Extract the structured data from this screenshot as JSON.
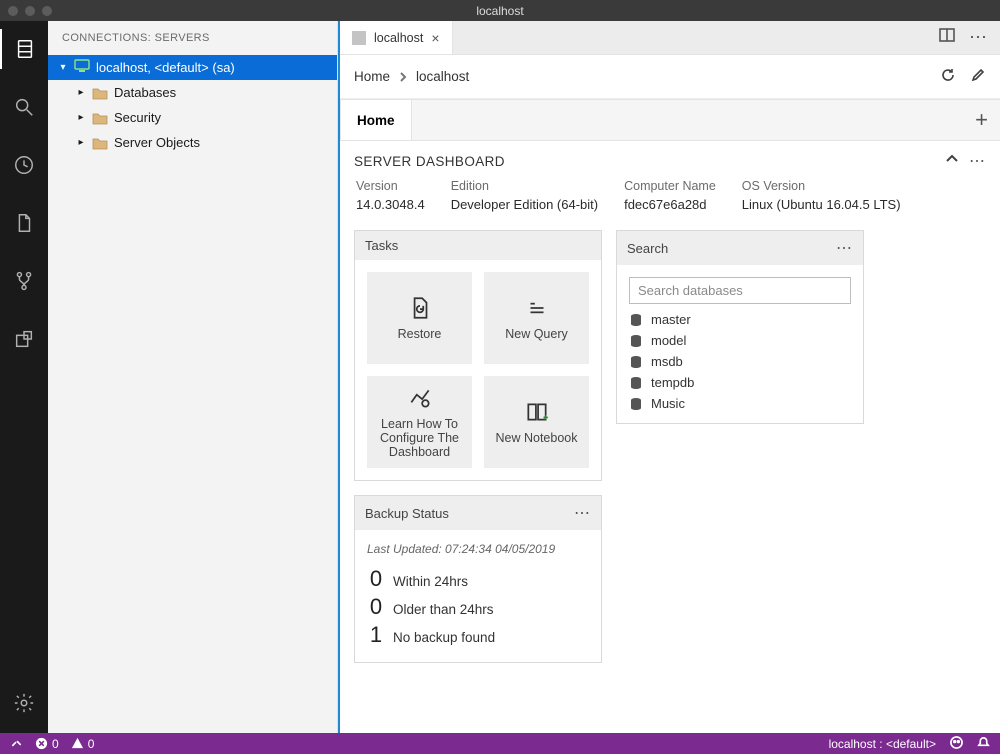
{
  "window": {
    "title": "localhost"
  },
  "sidebar": {
    "title": "CONNECTIONS: SERVERS",
    "connection_label": "localhost, <default> (sa)",
    "children": [
      {
        "label": "Databases"
      },
      {
        "label": "Security"
      },
      {
        "label": "Server Objects"
      }
    ]
  },
  "tab": {
    "label": "localhost"
  },
  "breadcrumb": {
    "root": "Home",
    "current": "localhost"
  },
  "home_tab": "Home",
  "dashboard": {
    "title": "SERVER DASHBOARD",
    "props": {
      "version_label": "Version",
      "version_value": "14.0.3048.4",
      "edition_label": "Edition",
      "edition_value": "Developer Edition (64-bit)",
      "computer_label": "Computer Name",
      "computer_value": "fdec67e6a28d",
      "os_label": "OS Version",
      "os_value": "Linux (Ubuntu 16.04.5 LTS)"
    }
  },
  "tasks": {
    "title": "Tasks",
    "restore": "Restore",
    "new_query": "New Query",
    "learn": "Learn How To Configure The Dashboard",
    "new_notebook": "New Notebook"
  },
  "search": {
    "title": "Search",
    "placeholder": "Search databases",
    "dbs": [
      "master",
      "model",
      "msdb",
      "tempdb",
      "Music"
    ]
  },
  "backup": {
    "title": "Backup Status",
    "meta": "Last Updated: 07:24:34 04/05/2019",
    "rows": [
      {
        "n": "0",
        "label": "Within 24hrs"
      },
      {
        "n": "0",
        "label": "Older than 24hrs"
      },
      {
        "n": "1",
        "label": "No backup found"
      }
    ]
  },
  "statusbar": {
    "errors": "0",
    "warnings": "0",
    "connection": "localhost : <default>"
  }
}
